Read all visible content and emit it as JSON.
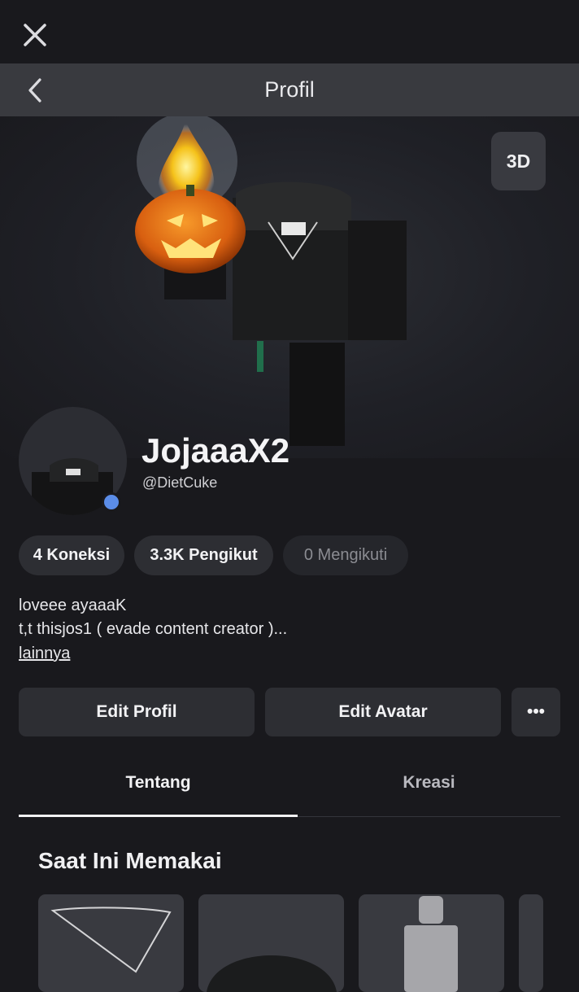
{
  "top": {
    "close_icon": "close-icon"
  },
  "nav": {
    "title": "Profil",
    "back_icon": "chevron-left-icon"
  },
  "hero": {
    "view_3d_label": "3D"
  },
  "profile": {
    "display_name": "JojaaaX2",
    "username": "@DietCuke",
    "status_color": "#5b8de8"
  },
  "stats": {
    "connections": "4 Koneksi",
    "followers": "3.3K Pengikut",
    "following": "0 Mengikuti"
  },
  "bio": {
    "line1": "loveee ayaaaK",
    "line2": "t,t thisjos1 ( evade content creator )...",
    "more_label": "lainnya"
  },
  "actions": {
    "edit_profile": "Edit Profil",
    "edit_avatar": "Edit Avatar",
    "more": "•••"
  },
  "tabs": [
    {
      "label": "Tentang",
      "active": true
    },
    {
      "label": "Kreasi",
      "active": false
    }
  ],
  "wearing": {
    "title": "Saat Ini Memakai",
    "items": [
      "necklace",
      "fur-jacket",
      "avatar-silhouette",
      "item"
    ]
  }
}
